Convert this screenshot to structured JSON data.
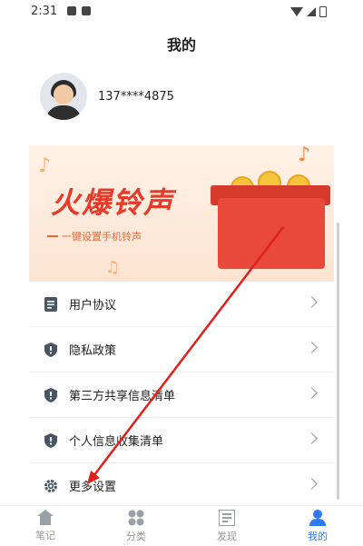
{
  "status": {
    "time": "2:31"
  },
  "header": {
    "title": "我的"
  },
  "profile": {
    "phone": "137****4875"
  },
  "banner": {
    "title": "火爆铃声",
    "subtitle": "一键设置手机铃声"
  },
  "menu": {
    "items": [
      {
        "label": "用户协议",
        "icon": "document-icon"
      },
      {
        "label": "隐私政策",
        "icon": "shield-icon"
      },
      {
        "label": "第三方共享信息清单",
        "icon": "shield-icon"
      },
      {
        "label": "个人信息收集清单",
        "icon": "shield-icon"
      },
      {
        "label": "更多设置",
        "icon": "gear-icon"
      }
    ]
  },
  "tabs": [
    {
      "label": "笔记",
      "icon": "home-icon",
      "active": false
    },
    {
      "label": "分类",
      "icon": "grid-icon",
      "active": false
    },
    {
      "label": "发现",
      "icon": "news-icon",
      "active": false
    },
    {
      "label": "我的",
      "icon": "user-icon",
      "active": true
    }
  ],
  "colors": {
    "accent": "#2f7bf5",
    "banner_red": "#e73a2b",
    "arrow_red": "#e0201c"
  }
}
